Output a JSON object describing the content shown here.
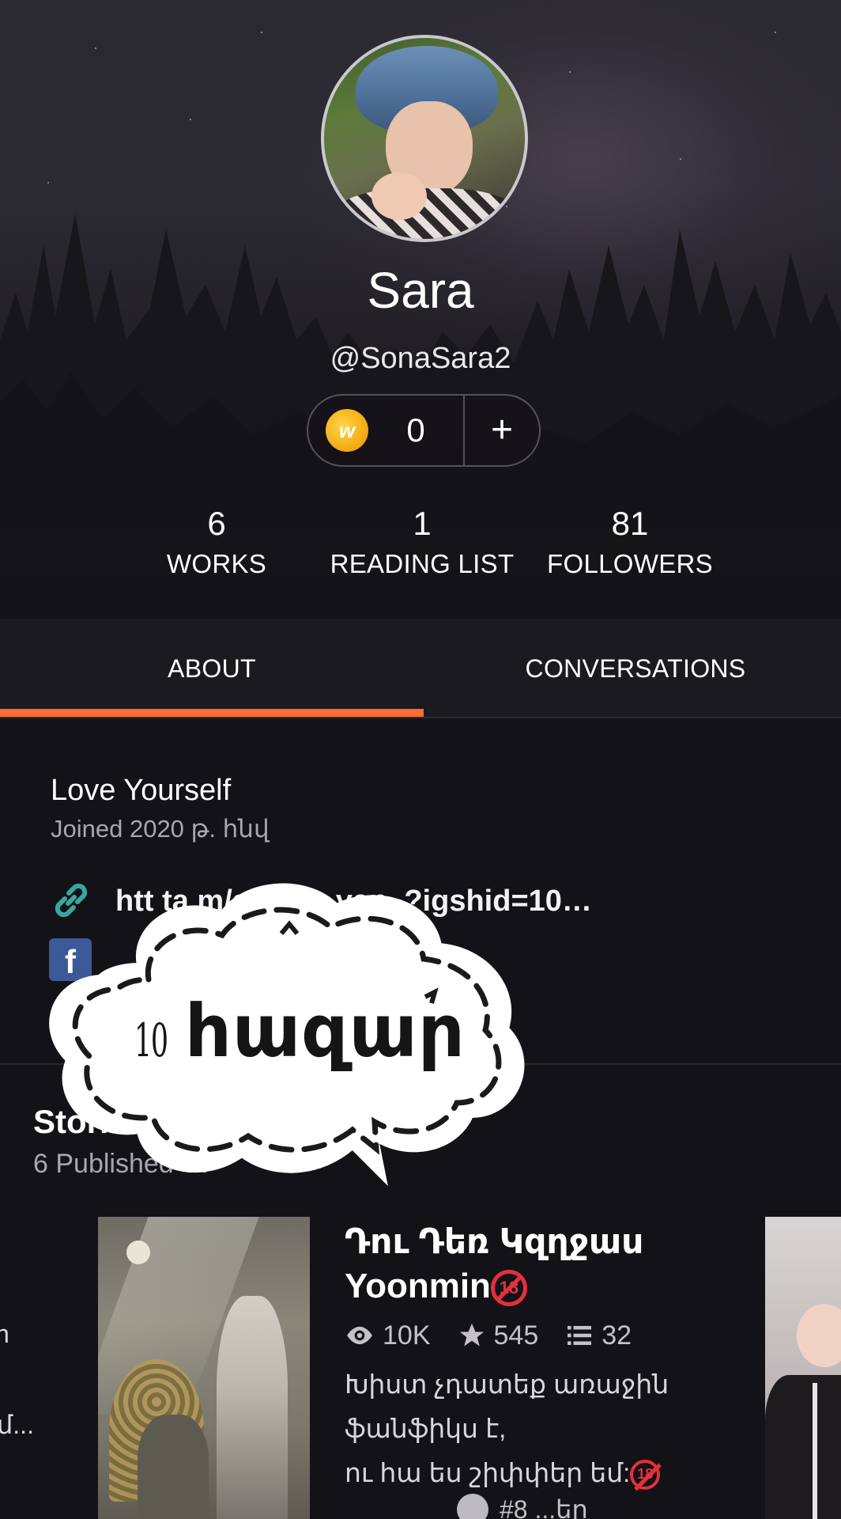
{
  "profile": {
    "display_name": "Sara",
    "username": "@SonaSara2",
    "coins": {
      "count": "0",
      "add_label": "+",
      "icon": "wattpad-coin-icon"
    }
  },
  "stats": [
    {
      "value": "6",
      "label": "WORKS"
    },
    {
      "value": "1",
      "label": "READING LIST"
    },
    {
      "value": "81",
      "label": "FOLLOWERS"
    }
  ],
  "tabs": {
    "active": "ABOUT",
    "items": [
      {
        "label": "ABOUT"
      },
      {
        "label": "CONVERSATIONS"
      }
    ]
  },
  "about": {
    "tagline": "Love Yourself",
    "joined": "Joined 2020 թ. հնվ",
    "link_text": "htt          ta           m/son_s_yan_?igshid=10…",
    "link_icon": "link-icon",
    "facebook_icon": "facebook-icon"
  },
  "stories": {
    "heading": "Stories b",
    "subheading": "6 Published St",
    "left_peek": [
      "n",
      "մ..."
    ],
    "featured": {
      "title_line1": "Դու Դեռ Կզղջաս",
      "title_line2": "Yoonmin",
      "badge": "18",
      "reads": "10K",
      "votes": "545",
      "parts": "32",
      "description_line1": "Խիստ չդատեք առաջին",
      "description_line2": "ֆանֆիկս է,",
      "description_line3": "ու հա ես շիփփեր եմ:",
      "description_badge": "18",
      "rank": "#8   ...եր"
    }
  },
  "sticker": {
    "number": "10",
    "word": "հազար"
  },
  "colors": {
    "accent": "#ff6a32",
    "background": "#131216",
    "tab_bar": "#1b1a1f",
    "link_icon": "#3aa6a0",
    "facebook": "#3b5998",
    "mature_badge": "#e2313c"
  }
}
